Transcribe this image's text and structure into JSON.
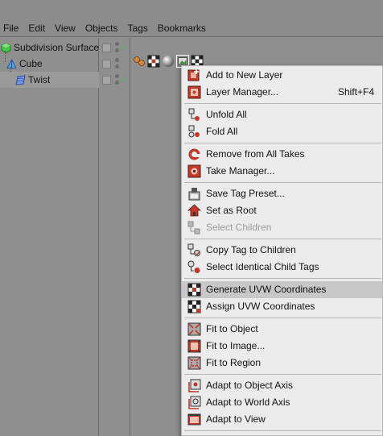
{
  "menubar": {
    "items": [
      "File",
      "Edit",
      "View",
      "Objects",
      "Tags",
      "Bookmarks"
    ]
  },
  "objects": [
    {
      "name": "Subdivision Surface",
      "icon": "subdivision-icon"
    },
    {
      "name": "Cube",
      "icon": "cube-icon"
    },
    {
      "name": "Twist",
      "icon": "twist-deformer-icon"
    }
  ],
  "context_menu": {
    "items": [
      {
        "label": "Add to New Layer",
        "icon": "layer-add-icon"
      },
      {
        "label": "Layer Manager...",
        "shortcut": "Shift+F4",
        "icon": "layer-manager-icon"
      },
      {
        "label": "Unfold All",
        "icon": "unfold-icon"
      },
      {
        "label": "Fold All",
        "icon": "fold-icon"
      },
      {
        "label": "Remove from All Takes",
        "icon": "take-remove-icon"
      },
      {
        "label": "Take Manager...",
        "icon": "take-manager-icon"
      },
      {
        "label": "Save Tag Preset...",
        "icon": "save-preset-icon"
      },
      {
        "label": "Set as Root",
        "icon": "root-icon"
      },
      {
        "label": "Select Children",
        "icon": "select-children-icon",
        "disabled": true
      },
      {
        "label": "Copy Tag to Children",
        "icon": "copy-tag-icon"
      },
      {
        "label": "Select Identical Child Tags",
        "icon": "select-tags-icon"
      },
      {
        "label": "Generate UVW Coordinates",
        "icon": "uvw-generate-icon",
        "highlighted": true
      },
      {
        "label": "Assign UVW Coordinates",
        "icon": "uvw-assign-icon"
      },
      {
        "label": "Fit to Object",
        "icon": "fit-object-icon"
      },
      {
        "label": "Fit to Image...",
        "icon": "fit-image-icon"
      },
      {
        "label": "Fit to Region",
        "icon": "fit-region-icon"
      },
      {
        "label": "Adapt to Object Axis",
        "icon": "axis-object-icon"
      },
      {
        "label": "Adapt to World Axis",
        "icon": "axis-world-icon"
      },
      {
        "label": "Adapt to View",
        "icon": "adapt-view-icon"
      }
    ]
  },
  "colors": {
    "panel_bg": "#8f8f8f",
    "menu_bg": "#ececec",
    "menu_highlight": "#c8c8c8",
    "icon_red": "#c0392b",
    "check_green": "#32c83c"
  }
}
